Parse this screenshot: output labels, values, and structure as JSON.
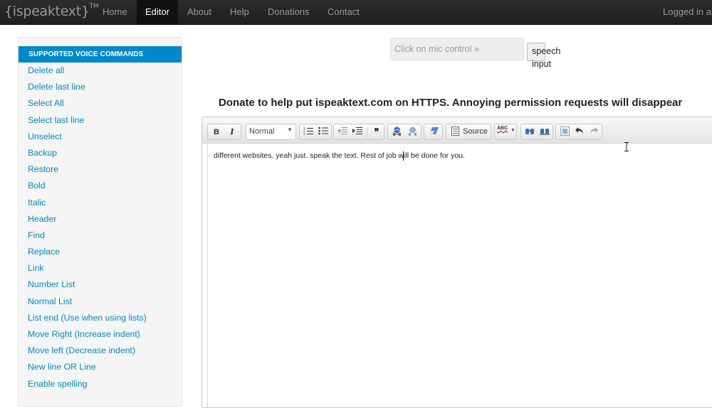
{
  "navbar": {
    "brand": "{ispeaktext}",
    "brand_tm": "TM",
    "items": [
      "Home",
      "Editor",
      "About",
      "Help",
      "Donations",
      "Contact"
    ],
    "active": "Editor",
    "user_text": "Logged in as"
  },
  "sidebar": {
    "header": "SUPPORTED VOICE COMMANDS",
    "items": [
      "Delete all",
      "Delete last line",
      "Select All",
      "Select last line",
      "Unselect",
      "Backup",
      "Restore",
      "Bold",
      "Italic",
      "Header",
      "Find",
      "Replace",
      "Link",
      "Number List",
      "Normal List",
      "List end (Use when using lists)",
      "Move Right (Increase indent)",
      "Move left (Decrease indent)",
      "New line OR Line",
      "Enable spelling"
    ]
  },
  "speech": {
    "placeholder": "Click on mic control »",
    "button_label": "speech input"
  },
  "donate_text": "Donate to help put ispeaktext.com on HTTPS. Annoying permission requests will disappear",
  "toolbar": {
    "bold": "B",
    "italic": "I",
    "format_value": "Normal",
    "source_label": "Source",
    "spell_label": "ABC"
  },
  "editor": {
    "content": "different websites. yeah just. speak the text. Rest of job will be done for you."
  },
  "colors": {
    "accent": "#0088cc",
    "navbar": "#222222"
  }
}
